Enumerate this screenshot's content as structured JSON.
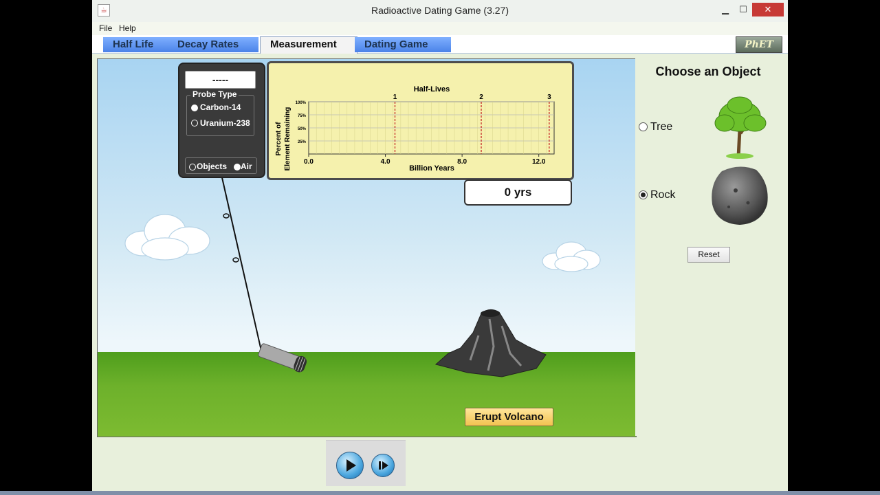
{
  "window": {
    "title": "Radioactive Dating Game (3.27)",
    "minimize": "▁",
    "maximize": "☐",
    "close": "✕"
  },
  "menu": {
    "file": "File",
    "help": "Help"
  },
  "tabs": [
    {
      "label": "Half Life",
      "active": false
    },
    {
      "label": "Decay Rates",
      "active": false
    },
    {
      "label": "Measurement",
      "active": true
    },
    {
      "label": "Dating Game",
      "active": false
    }
  ],
  "logo": {
    "text": "PhET"
  },
  "probe": {
    "readout": "-----",
    "type_label": "Probe Type",
    "options": [
      "Carbon-14",
      "Uranium-238"
    ],
    "selected": "Carbon-14",
    "target_options": [
      "Objects",
      "Air"
    ],
    "target_selected": "Air"
  },
  "chart_data": {
    "type": "line",
    "title": "Half-Lives",
    "xlabel": "Billion Years",
    "ylabel": "Percent of Element Remaining",
    "yticks": [
      "100%",
      "75%",
      "50%",
      "25%"
    ],
    "xticks": [
      "0.0",
      "4.0",
      "8.0",
      "12.0"
    ],
    "xlim": [
      0,
      12.8
    ],
    "ylim": [
      0,
      100
    ],
    "half_life_markers": [
      {
        "label": "1",
        "x": 4.5
      },
      {
        "label": "2",
        "x": 9.0
      },
      {
        "label": "3",
        "x": 13.5
      }
    ],
    "series": [],
    "grid": true
  },
  "time_readout": "0 yrs",
  "erupt_button": "Erupt Volcano",
  "side": {
    "title": "Choose an Object",
    "objects": [
      {
        "label": "Tree",
        "selected": false
      },
      {
        "label": "Rock",
        "selected": true
      }
    ],
    "reset": "Reset"
  },
  "controls": {
    "play": "play",
    "step": "step"
  }
}
